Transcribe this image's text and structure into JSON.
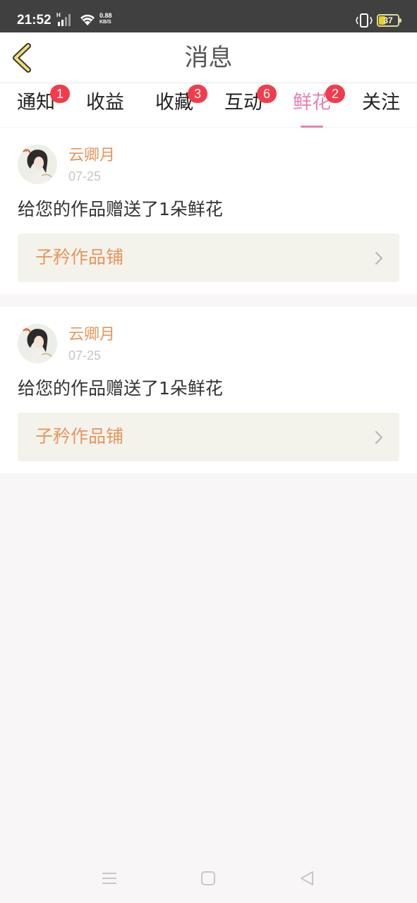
{
  "status_bar": {
    "time": "21:52",
    "network_type": "H",
    "speed_value": "0.88",
    "speed_unit": "KB/S",
    "battery": "37",
    "icons": [
      "signal-icon",
      "wifi-icon",
      "vibrate-icon",
      "battery-icon"
    ]
  },
  "header": {
    "title": "消息",
    "back_icon": "chevron-left-icon"
  },
  "tabs": [
    {
      "label": "通知",
      "badge": "1",
      "active": false
    },
    {
      "label": "收益",
      "badge": "",
      "active": false
    },
    {
      "label": "收藏",
      "badge": "3",
      "active": false
    },
    {
      "label": "互动",
      "badge": "6",
      "active": false
    },
    {
      "label": "鲜花",
      "badge": "2",
      "active": true
    },
    {
      "label": "关注",
      "badge": "",
      "active": false
    }
  ],
  "messages": [
    {
      "sender": "云卿月",
      "date": "07-25",
      "text": "给您的作品赠送了1朵鲜花",
      "work_title": "子矜作品铺"
    },
    {
      "sender": "云卿月",
      "date": "07-25",
      "text": "给您的作品赠送了1朵鲜花",
      "work_title": "子矜作品铺"
    }
  ],
  "nav_bar": {
    "icons": [
      "menu-icon",
      "home-icon",
      "back-icon"
    ]
  },
  "colors": {
    "accent_tab": "#e87fb2",
    "badge": "#f23c4b",
    "sender": "#e8955a",
    "status_bar": "#404040",
    "back_arrow": "#e8d21c"
  }
}
